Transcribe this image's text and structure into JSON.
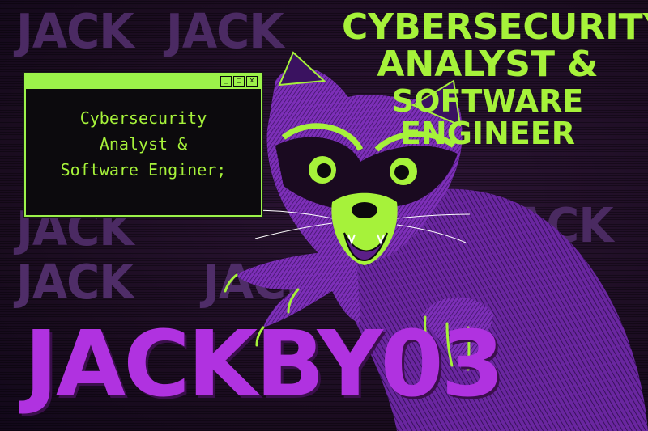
{
  "background_words": [
    "JACK",
    "JACK",
    "JACK",
    "JACK",
    "JACK",
    "JACK"
  ],
  "title": {
    "line1": "CYBERSECURITY",
    "line2": "ANALYST &",
    "line3": "SOFTWARE",
    "line4": "ENGINEER"
  },
  "terminal": {
    "buttons": {
      "minimize": "_",
      "maximize": "□",
      "close": "x"
    },
    "lines": [
      "Cybersecurity",
      "Analyst &",
      "Software Enginer;"
    ]
  },
  "brand": "JACKBY03",
  "colors": {
    "accent_green": "#a6f23a",
    "brand_purple": "#b032e0",
    "background": "#1f0f24",
    "bg_text": "#4b2a63"
  },
  "mascot": "raccoon"
}
